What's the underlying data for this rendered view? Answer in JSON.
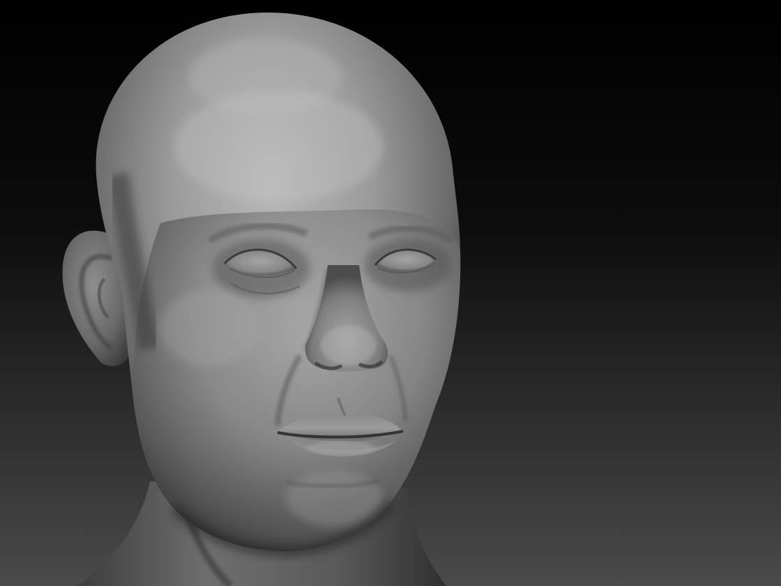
{
  "scene": {
    "subject": "sculpted-head",
    "colors": {
      "background_top": "#000000",
      "background_bottom": "#4a4a4a",
      "clay_highlight": "#b4b4b4",
      "clay_mid": "#7e7e7e",
      "clay_shadow": "#2e2e2e"
    }
  }
}
